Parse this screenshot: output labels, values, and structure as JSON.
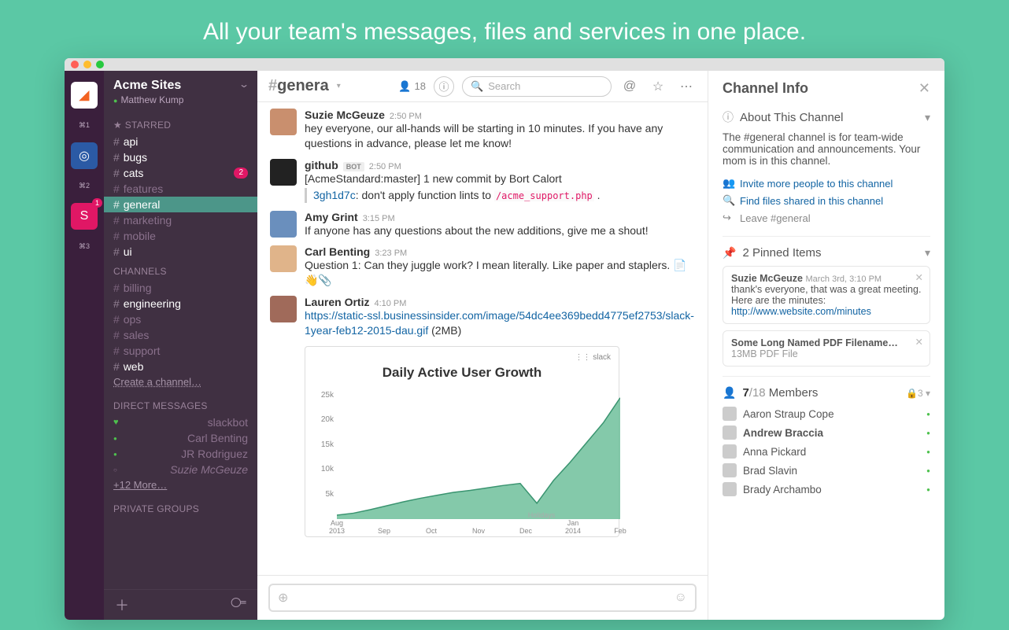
{
  "hero": "All your team's messages, files and services in one place.",
  "workspaces": [
    {
      "label": "⌘1",
      "badge": null
    },
    {
      "label": "⌘2",
      "badge": null
    },
    {
      "label": "⌘3",
      "badge": "1"
    }
  ],
  "sidebar": {
    "team": "Acme Sites",
    "user": "Matthew Kump",
    "starred_label": "STARRED",
    "starred": [
      {
        "name": "api",
        "bold": true
      },
      {
        "name": "bugs",
        "bold": true
      },
      {
        "name": "cats",
        "bold": true,
        "badge": "2"
      },
      {
        "name": "features",
        "bold": false
      },
      {
        "name": "general",
        "bold": false,
        "active": true
      },
      {
        "name": "marketing",
        "bold": false
      },
      {
        "name": "mobile",
        "bold": false
      },
      {
        "name": "ui",
        "bold": true
      }
    ],
    "channels_label": "CHANNELS",
    "channels": [
      {
        "name": "billing",
        "bold": false
      },
      {
        "name": "engineering",
        "bold": true
      },
      {
        "name": "ops",
        "bold": false
      },
      {
        "name": "sales",
        "bold": false
      },
      {
        "name": "support",
        "bold": false
      },
      {
        "name": "web",
        "bold": true
      }
    ],
    "create_channel": "Create a channel…",
    "dm_label": "DIRECT MESSAGES",
    "dms": [
      {
        "name": "slackbot",
        "kind": "heart"
      },
      {
        "name": "Carl Benting",
        "kind": "on"
      },
      {
        "name": "JR Rodriguez",
        "kind": "on"
      },
      {
        "name": "Suzie McGeuze",
        "kind": "away"
      }
    ],
    "more": "+12 More…",
    "groups_label": "PRIVATE GROUPS"
  },
  "header": {
    "channel": "genera",
    "members": "18",
    "search_placeholder": "Search"
  },
  "messages": [
    {
      "user": "Suzie McGeuze",
      "time": "2:50 PM",
      "av": "#c98f6e",
      "body": "hey everyone, our all-hands will be starting in 10 minutes. If you have any questions in advance, please let me know!"
    },
    {
      "user": "github",
      "bot": "BOT",
      "time": "2:50 PM",
      "av": "#222",
      "body": "[AcmeStandard:master] 1 new commit by Bort Calort",
      "commit_hash": "3gh1d7c",
      "commit_msg": ": don't apply function lints to ",
      "commit_file": "/acme_support.php",
      "trail": " ."
    },
    {
      "user": "Amy Grint",
      "time": "3:15 PM",
      "av": "#6a8fbd",
      "body": "If anyone has any questions about the new additions, give me a shout!"
    },
    {
      "user": "Carl Benting",
      "time": "3:23 PM",
      "av": "#e0b48a",
      "body": "Question 1: Can they juggle work? I mean literally. Like paper and staplers. 📄👋📎"
    },
    {
      "user": "Lauren Ortiz",
      "time": "4:10 PM",
      "av": "#a06a5a",
      "link": "https://static-ssl.businessinsider.com/image/54dc4ee369bedd4775ef2753/slack-1year-feb12-2015-dau.gif",
      "link_suffix": " (2MB)"
    }
  ],
  "right": {
    "title": "Channel Info",
    "about_label": "About This Channel",
    "about": "The #general channel is for team-wide communication and announcements. Your mom is in this channel.",
    "links": [
      "Invite more people to this channel",
      "Find files shared in this channel",
      "Leave #general"
    ],
    "pinned_label": "2 Pinned Items",
    "pins": [
      {
        "user": "Suzie McGeuze",
        "time": "March 3rd, 3:10 PM",
        "text": "thank's everyone, that was a great meeting. Here are the minutes: ",
        "url": "http://www.website.com/minutes"
      },
      {
        "title": "Some Long Named PDF Filename…",
        "sub": "13MB PDF File"
      }
    ],
    "members_label_a": "7",
    "members_label_b": "/18",
    "members_label_c": " Members",
    "lock": "3",
    "members": [
      "Aaron Straup Cope",
      "Andrew Braccia",
      "Anna Pickard",
      "Brad Slavin",
      "Brady Archambo"
    ]
  },
  "chart_data": {
    "type": "line",
    "title": "Daily Active User Growth",
    "logo": "⋮⋮ slack",
    "ylabel": "",
    "xlabel": "",
    "ylim": [
      0,
      27000
    ],
    "yticks": [
      5000,
      10000,
      15000,
      20000,
      25000
    ],
    "ytick_labels": [
      "5k",
      "10k",
      "15k",
      "20k",
      "25k"
    ],
    "categories": [
      "Aug\n2013",
      "Sep",
      "Oct",
      "Nov",
      "Dec",
      "Jan\n2014",
      "Feb"
    ],
    "annotation": "Holidays",
    "values": [
      800,
      1200,
      1900,
      2700,
      3500,
      4200,
      4800,
      5400,
      5800,
      6300,
      6800,
      7200,
      3200,
      7800,
      11500,
      15500,
      19500,
      24500
    ]
  }
}
